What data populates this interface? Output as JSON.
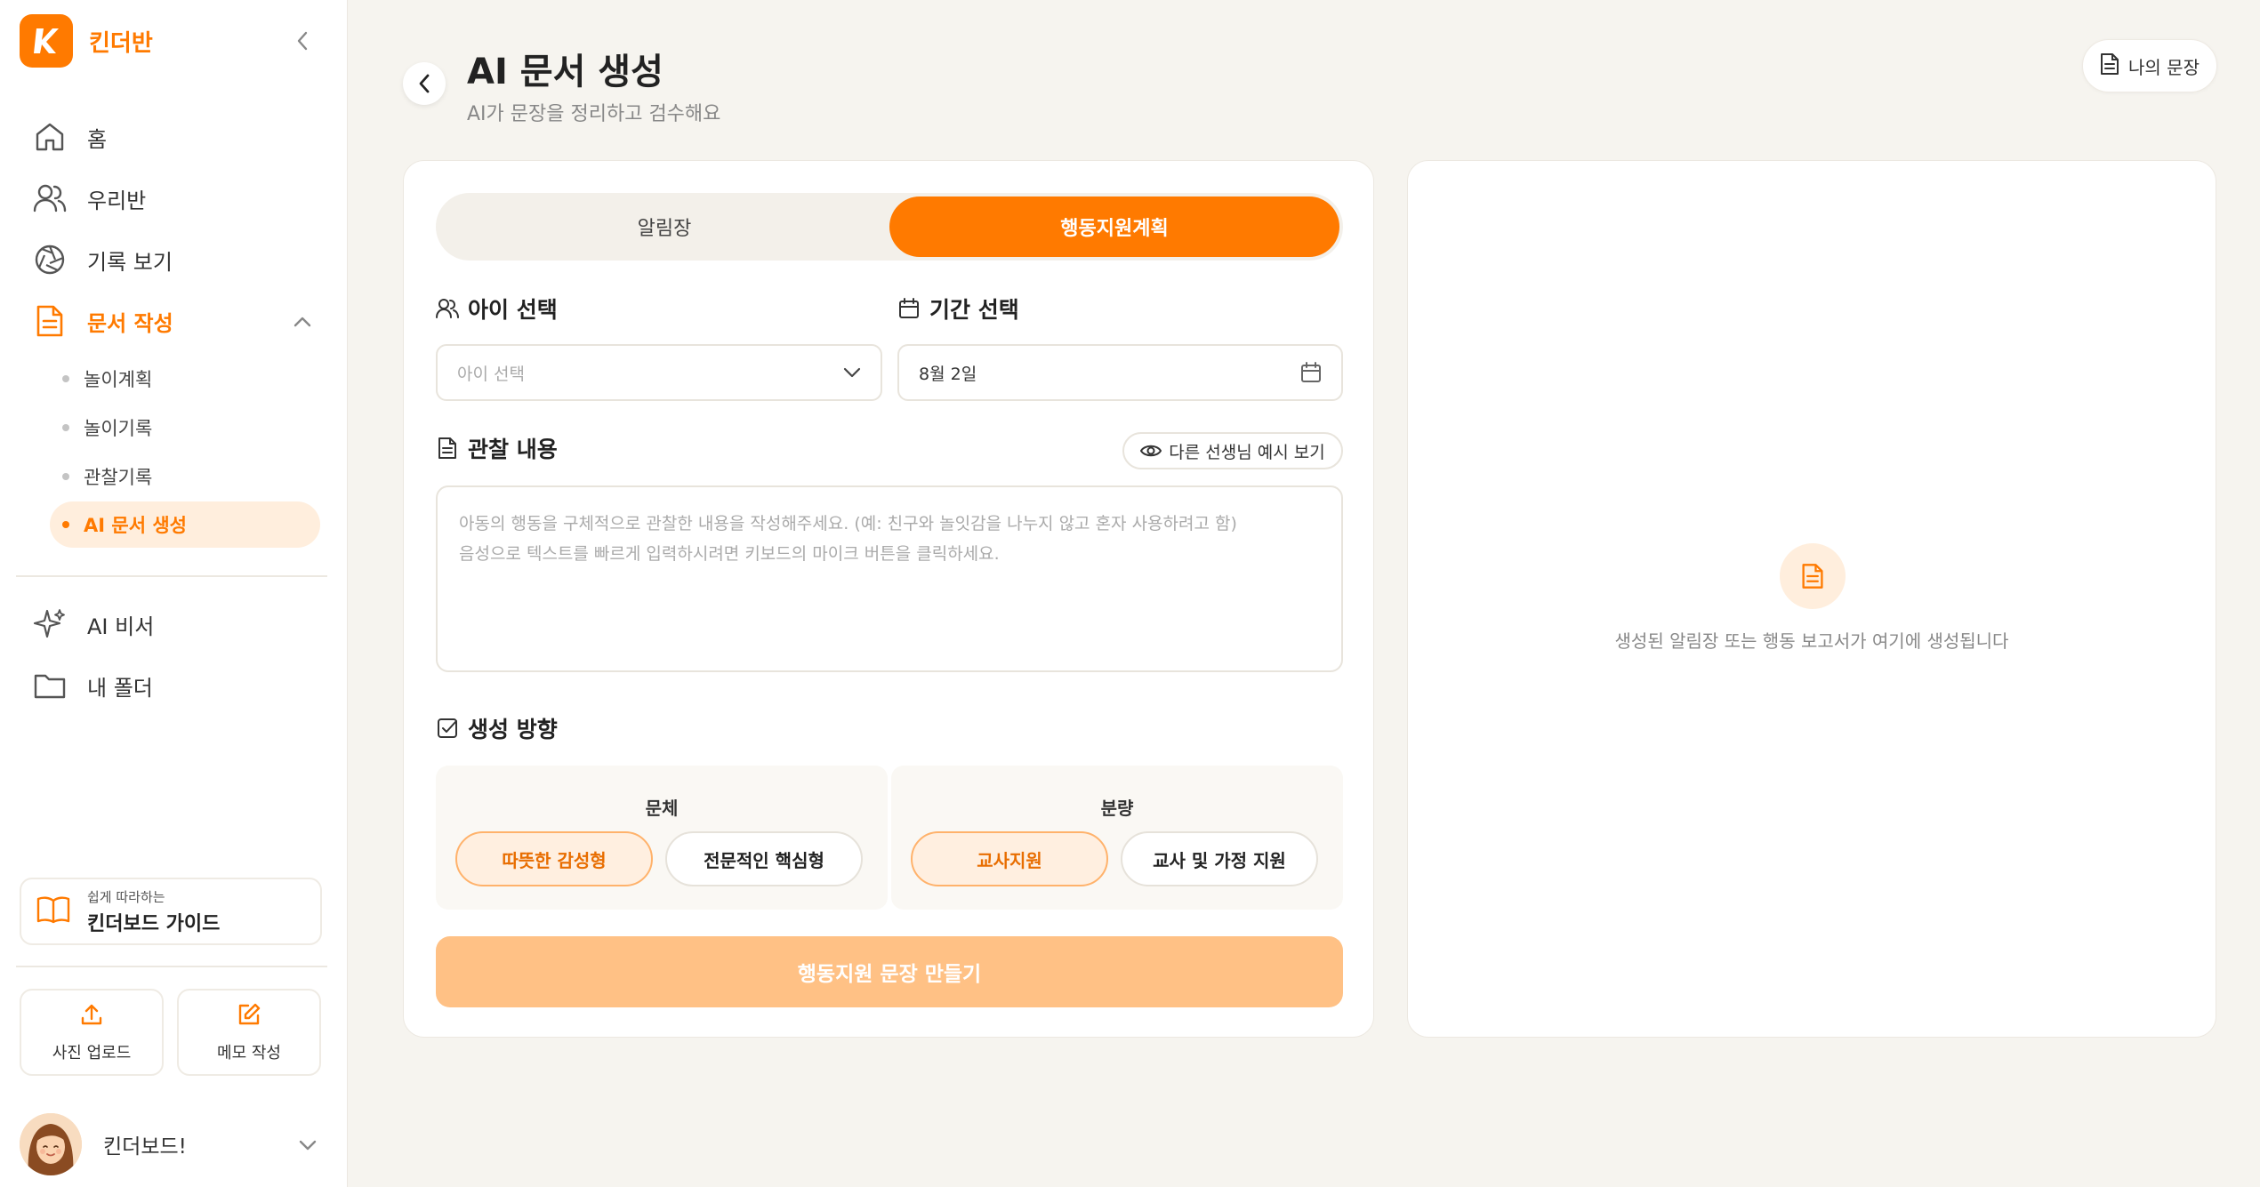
{
  "brand": {
    "name": "킨더반",
    "logo_letter": "K",
    "color": "#ff7a00"
  },
  "sidebar": {
    "nav": [
      {
        "label": "홈",
        "icon": "home-icon"
      },
      {
        "label": "우리반",
        "icon": "users-icon"
      },
      {
        "label": "기록 보기",
        "icon": "aperture-icon"
      },
      {
        "label": "문서 작성",
        "icon": "document-icon",
        "active": true
      }
    ],
    "sub_items": [
      {
        "label": "놀이계획"
      },
      {
        "label": "놀이기록"
      },
      {
        "label": "관찰기록"
      },
      {
        "label": "AI 문서 생성",
        "active": true
      }
    ],
    "nav2": [
      {
        "label": "AI 비서",
        "icon": "sparkle-icon"
      },
      {
        "label": "내 폴더",
        "icon": "folder-icon"
      }
    ],
    "guide": {
      "small": "쉽게 따라하는",
      "big": "킨더보드 가이드"
    },
    "quick": [
      {
        "label": "사진 업로드",
        "icon": "upload-icon"
      },
      {
        "label": "메모 작성",
        "icon": "edit-icon"
      }
    ],
    "profile": {
      "name": "킨더보드!"
    }
  },
  "header": {
    "title": "AI 문서 생성",
    "subtitle": "AI가 문장을 정리하고 검수해요",
    "my_docs_label": "나의 문장"
  },
  "form": {
    "tabs": [
      {
        "label": "알림장",
        "active": false
      },
      {
        "label": "행동지원계획",
        "active": true
      }
    ],
    "child_label": "아이 선택",
    "child_placeholder": "아이 선택",
    "period_label": "기간 선택",
    "period_value": "8월 2일",
    "observation_label": "관찰 내용",
    "example_button": "다른 선생님 예시 보기",
    "observation_placeholder_line1": "아동의 행동을 구체적으로 관찰한 내용을 작성해주세요. (예: 친구와 놀잇감을 나누지 않고 혼자 사용하려고 함)",
    "observation_placeholder_line2": "음성으로 텍스트를 빠르게 입력하시려면 키보드의 마이크 버튼을 클릭하세요.",
    "direction_label": "생성 방향",
    "style_group": {
      "title": "문체",
      "options": [
        {
          "label": "따뜻한 감성형",
          "selected": true
        },
        {
          "label": "전문적인 핵심형",
          "selected": false
        }
      ]
    },
    "amount_group": {
      "title": "분량",
      "options": [
        {
          "label": "교사지원",
          "selected": true
        },
        {
          "label": "교사 및 가정 지원",
          "selected": false
        }
      ]
    },
    "submit_label": "행동지원 문장 만들기"
  },
  "preview": {
    "empty_text": "생성된 알림장 또는 행동 보고서가 여기에 생성됩니다"
  }
}
